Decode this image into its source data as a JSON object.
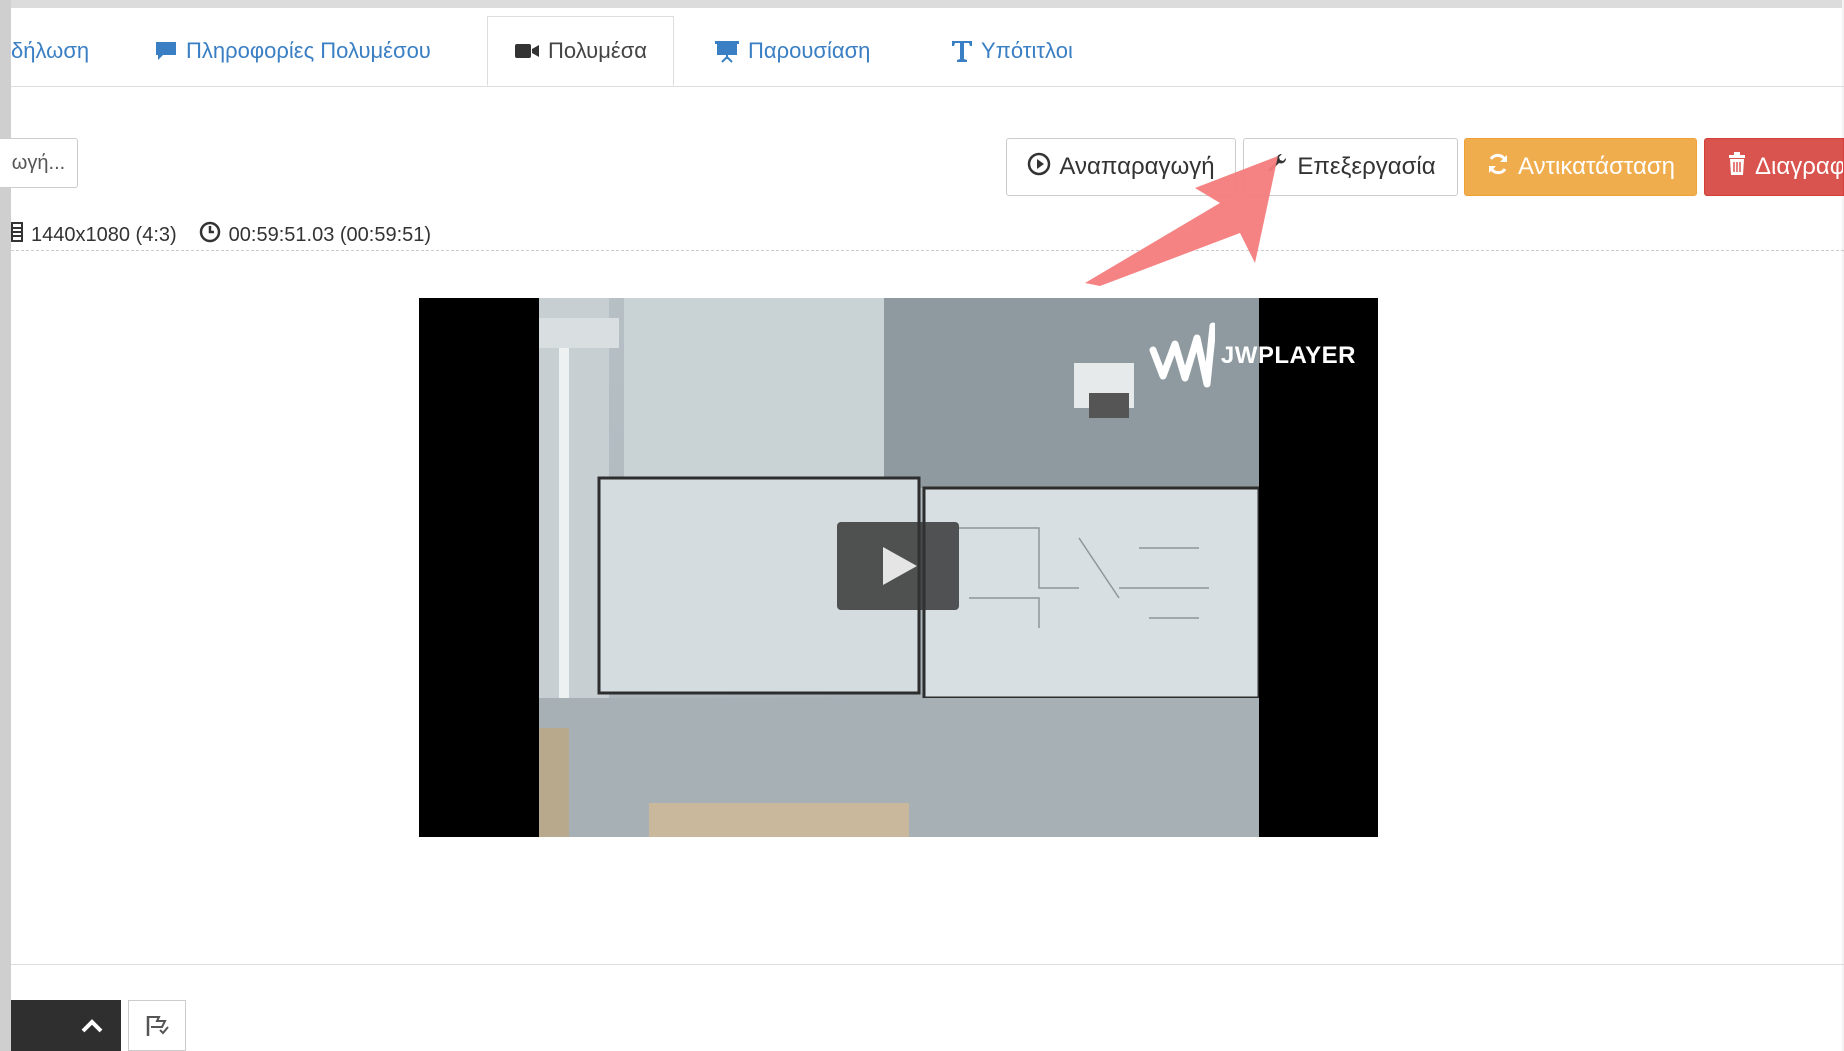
{
  "tabs": [
    {
      "label": "δήλωση",
      "icon": "none",
      "active": false
    },
    {
      "label": "Πληροφορίες Πολυμέσου",
      "icon": "comment-icon",
      "active": false
    },
    {
      "label": "Πολυμέσα",
      "icon": "video-camera-icon",
      "active": true
    },
    {
      "label": "Παρουσίαση",
      "icon": "presentation-icon",
      "active": false
    },
    {
      "label": "Υπότιτλοι",
      "icon": "text-icon",
      "active": false
    }
  ],
  "toolbar": {
    "left_label": "ωγή...",
    "play_label": "Αναπαραγωγή",
    "edit_label": "Επεξεργασία",
    "replace_label": "Αντικατάσταση",
    "delete_label": "Διαγραφ"
  },
  "info": {
    "resolution": "1440x1080 (4:3)",
    "duration": "00:59:51.03 (00:59:51)"
  },
  "player": {
    "brand": "JWPLAYER"
  },
  "colors": {
    "link": "#3a7fc3",
    "warning": "#f0ad4e",
    "danger": "#d9534f",
    "arrow": "#f47c7c"
  }
}
